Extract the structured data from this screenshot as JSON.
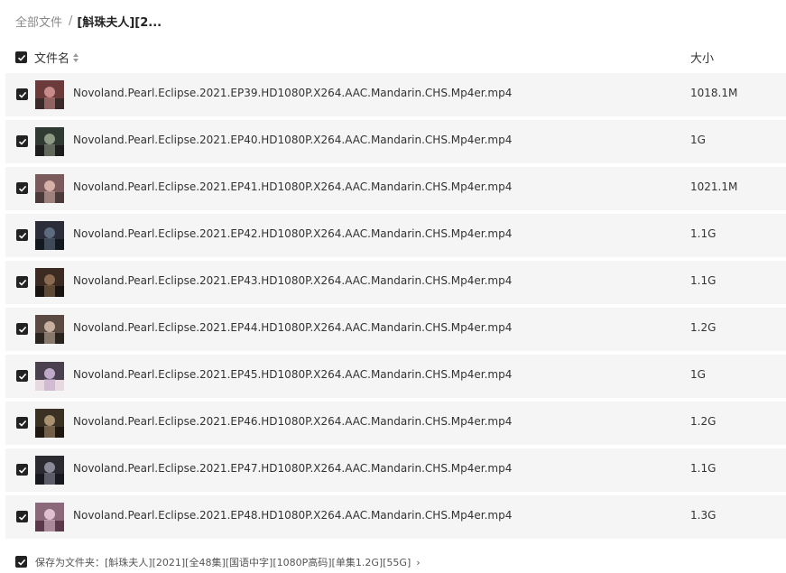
{
  "breadcrumb": {
    "root": "全部文件",
    "separator": "/",
    "current": "[斛珠夫人][2..."
  },
  "header": {
    "name_label": "文件名",
    "size_label": "大小"
  },
  "files": [
    {
      "name": "Novoland.Pearl.Eclipse.2021.EP39.HD1080P.X264.AAC.Mandarin.CHS.Mp4er.mp4",
      "size": "1018.1M"
    },
    {
      "name": "Novoland.Pearl.Eclipse.2021.EP40.HD1080P.X264.AAC.Mandarin.CHS.Mp4er.mp4",
      "size": "1G"
    },
    {
      "name": "Novoland.Pearl.Eclipse.2021.EP41.HD1080P.X264.AAC.Mandarin.CHS.Mp4er.mp4",
      "size": "1021.1M"
    },
    {
      "name": "Novoland.Pearl.Eclipse.2021.EP42.HD1080P.X264.AAC.Mandarin.CHS.Mp4er.mp4",
      "size": "1.1G"
    },
    {
      "name": "Novoland.Pearl.Eclipse.2021.EP43.HD1080P.X264.AAC.Mandarin.CHS.Mp4er.mp4",
      "size": "1.1G"
    },
    {
      "name": "Novoland.Pearl.Eclipse.2021.EP44.HD1080P.X264.AAC.Mandarin.CHS.Mp4er.mp4",
      "size": "1.2G"
    },
    {
      "name": "Novoland.Pearl.Eclipse.2021.EP45.HD1080P.X264.AAC.Mandarin.CHS.Mp4er.mp4",
      "size": "1G"
    },
    {
      "name": "Novoland.Pearl.Eclipse.2021.EP46.HD1080P.X264.AAC.Mandarin.CHS.Mp4er.mp4",
      "size": "1.2G"
    },
    {
      "name": "Novoland.Pearl.Eclipse.2021.EP47.HD1080P.X264.AAC.Mandarin.CHS.Mp4er.mp4",
      "size": "1.1G"
    },
    {
      "name": "Novoland.Pearl.Eclipse.2021.EP48.HD1080P.X264.AAC.Mandarin.CHS.Mp4er.mp4",
      "size": "1.3G"
    }
  ],
  "footer": {
    "save_label": "保存为文件夹：[斛珠夫人][2021][全48集][国语中字][1080P高码][单集1.2G][55G]",
    "arrow": "›"
  },
  "colors": {
    "checkbox": "#222222",
    "row_bg": "#f5f5f6",
    "text": "#333333",
    "muted": "#8a8a8a"
  },
  "icons": {
    "checkbox": "checkbox-checked-icon",
    "sort": "sort-icon",
    "thumbnail": "video-thumbnail",
    "arrow": "chevron-right-icon"
  }
}
